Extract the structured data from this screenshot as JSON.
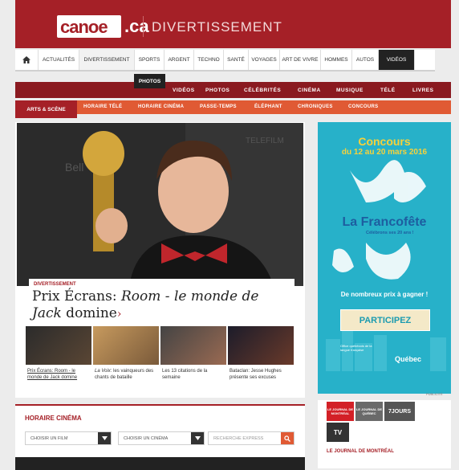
{
  "header": {
    "logo": "canoe",
    "logo_suffix": ".ca",
    "section": "DIVERTISSEMENT"
  },
  "main_nav": [
    {
      "label": "ACTUALITÉS"
    },
    {
      "label": "DIVERTISSEMENT"
    },
    {
      "label": "SPORTS"
    },
    {
      "label": "ARGENT"
    },
    {
      "label": "TECHNO"
    },
    {
      "label": "SANTÉ"
    },
    {
      "label": "VOYAGES"
    },
    {
      "label": "ART DE VIVRE"
    },
    {
      "label": "HOMMES"
    },
    {
      "label": "AUTOS"
    },
    {
      "label": "VIDÉOS"
    }
  ],
  "photos_tab": "PHOTOS",
  "sub_nav": [
    {
      "label": "VIDÉOS"
    },
    {
      "label": "PHOTOS"
    },
    {
      "label": "CÉLÉBRITÉS"
    },
    {
      "label": "CINÉMA"
    },
    {
      "label": "MUSIQUE"
    },
    {
      "label": "TÉLÉ"
    },
    {
      "label": "LIVRES"
    }
  ],
  "sub_nav2": {
    "active": "ARTS & SCÈNE",
    "items": [
      {
        "label": "HORAIRE TÉLÉ"
      },
      {
        "label": "HORAIRE CINÉMA"
      },
      {
        "label": "PASSE-TEMPS"
      },
      {
        "label": "ÉLÉPHANT"
      },
      {
        "label": "CHRONIQUES"
      },
      {
        "label": "CONCOURS"
      }
    ]
  },
  "hero": {
    "kicker": "DIVERTISSEMENT",
    "headline_a": "Prix Écrans: ",
    "headline_b": "Room - le monde de Jack",
    "headline_c": " domine",
    "arrow": "›"
  },
  "thumbs": [
    {
      "caption_a": "Prix Écrans: Room - le monde de Jack",
      "caption_b": " domine"
    },
    {
      "caption_a": "La Voix",
      "caption_b": ": les vainqueurs des chants de bataille"
    },
    {
      "caption_a": "",
      "caption_b": "Les 13 citations de la semaine"
    },
    {
      "caption_a": "",
      "caption_b": "Bataclan: Jesse Hughes présente ses excuses"
    }
  ],
  "ad": {
    "title": "Concours",
    "dates": "du 12 au 20 mars 2016",
    "brand": "La Francofête",
    "brand_sub": "Célébrons ses 20 ans !",
    "prizes": "De nombreux prix à gagner !",
    "button": "PARTICIPEZ",
    "office": "Office québécois de la langue française",
    "quebec": "Québec",
    "pub": "PUBLICITÉ"
  },
  "horaire": {
    "title": "HORAIRE CINÉMA",
    "film_select": "CHOISIR UN FILM",
    "cinema_select": "CHOISIR UN CINÉMA",
    "search_placeholder": "RECHERCHE EXPRESS"
  },
  "journals": {
    "j1": "LE JOURNAL DE MONTRÉAL",
    "j2": "LE JOURNAL DE QUÉBEC",
    "j3": "7JOURS",
    "j4": "TV",
    "label": "LE JOURNAL DE MONTRÉAL"
  },
  "colors": {
    "brand": "#a52027",
    "accent": "#e05a34",
    "ad_bg": "#27b1c9"
  }
}
